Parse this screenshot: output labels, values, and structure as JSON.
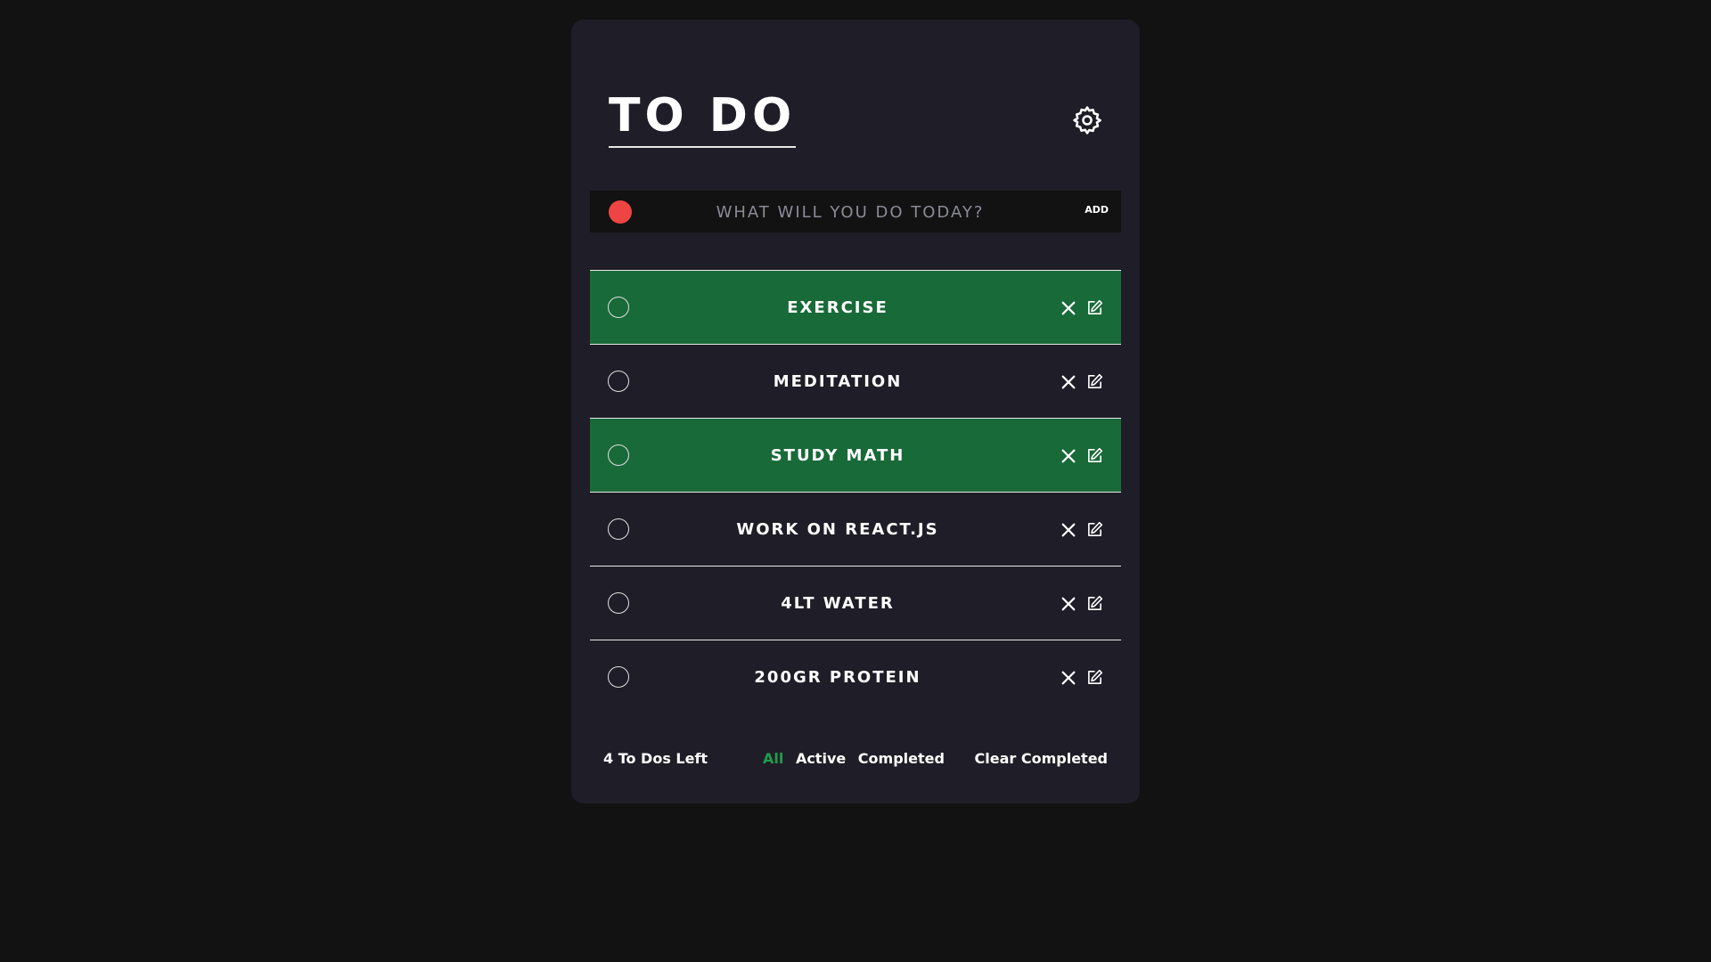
{
  "app": {
    "title": "TO DO",
    "settings_icon": "gear-icon"
  },
  "colors": {
    "page_bg": "#121212",
    "card_bg": "#1f1d27",
    "accent_green": "#196a39",
    "active_filter": "#1f9d4b",
    "add_dot": "#ef4444"
  },
  "add_bar": {
    "placeholder": "WHAT WILL YOU DO TODAY?",
    "button_label": "ADD"
  },
  "todos": [
    {
      "label": "EXERCISE",
      "highlighted": true
    },
    {
      "label": "MEDITATION",
      "highlighted": false
    },
    {
      "label": "STUDY MATH",
      "highlighted": true
    },
    {
      "label": "WORK ON REACT.JS",
      "highlighted": false
    },
    {
      "label": "4LT WATER",
      "highlighted": false
    },
    {
      "label": "200GR PROTEIN",
      "highlighted": false
    }
  ],
  "footer": {
    "left_count": "4 To Dos Left",
    "filters": {
      "all": "All",
      "active": "Active",
      "completed": "Completed"
    },
    "clear_label": "Clear Completed"
  }
}
